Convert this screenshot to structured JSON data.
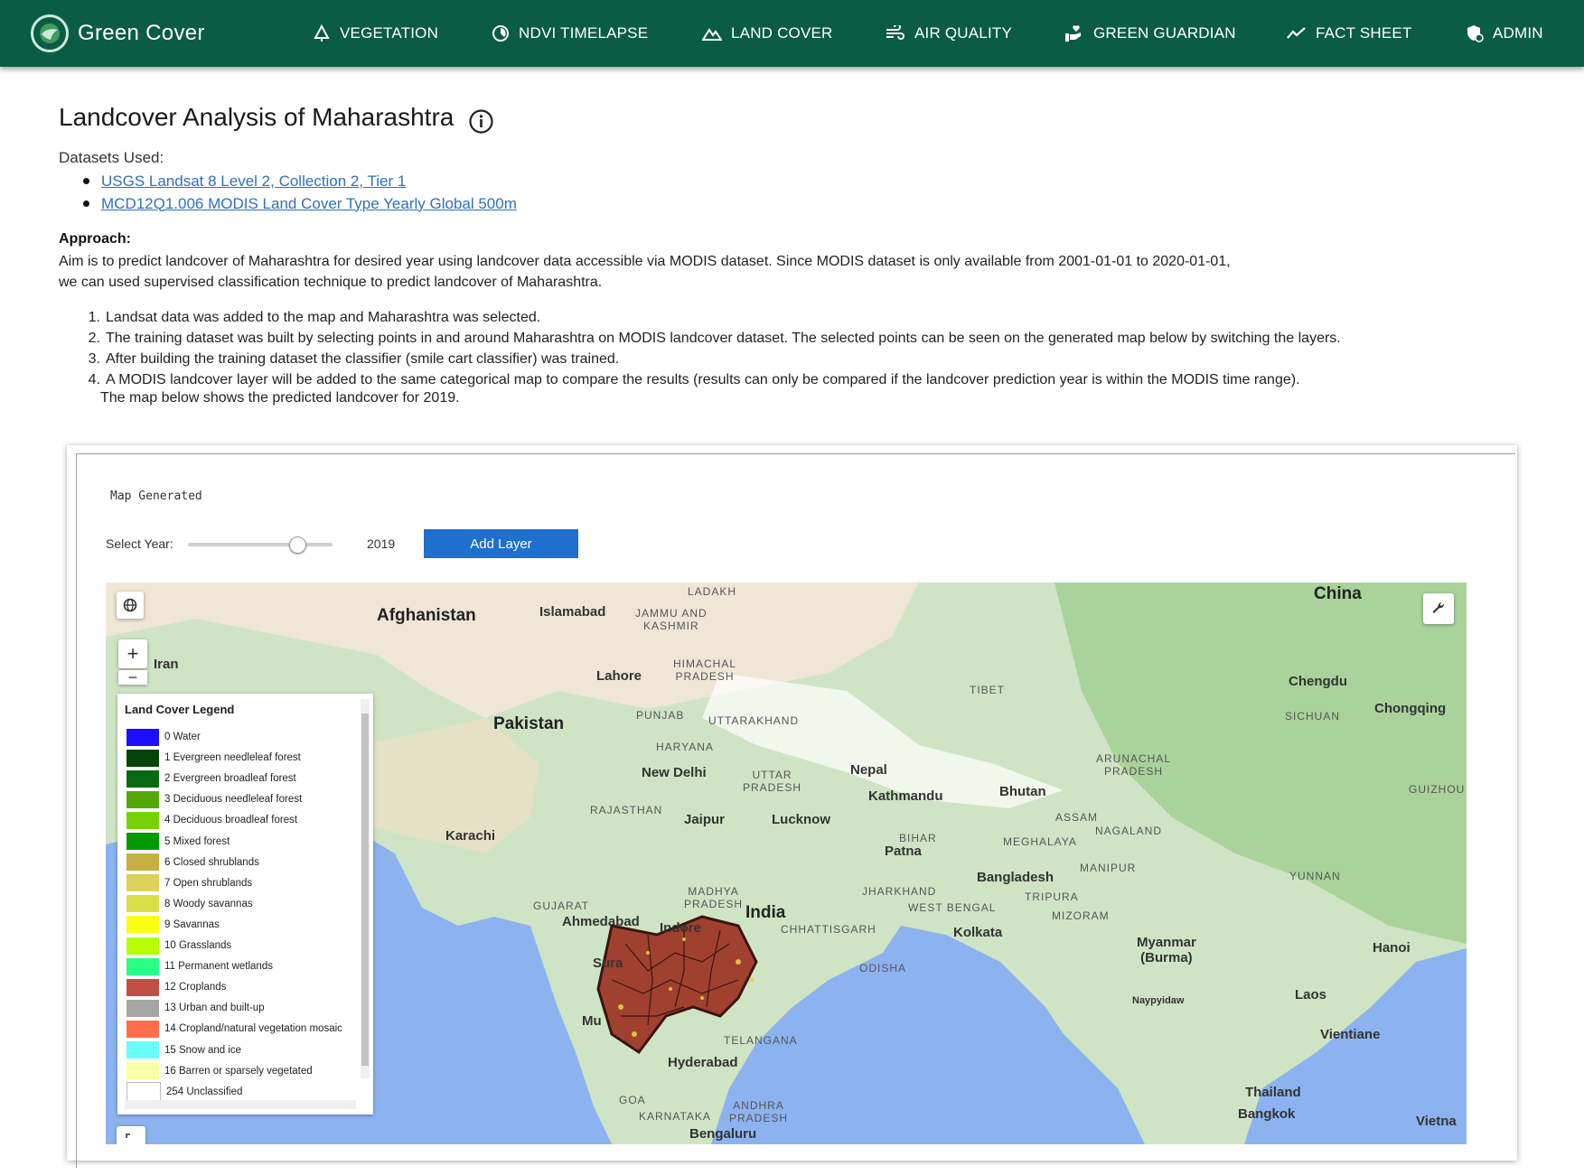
{
  "brand": {
    "title": "Green Cover"
  },
  "nav": [
    {
      "label": "VEGETATION",
      "icon": "tree-icon"
    },
    {
      "label": "NDVI TIMELAPSE",
      "icon": "timelapse-icon"
    },
    {
      "label": "LAND COVER",
      "icon": "terrain-icon"
    },
    {
      "label": "AIR QUALITY",
      "icon": "air-icon"
    },
    {
      "label": "GREEN GUARDIAN",
      "icon": "hand-heart-icon"
    },
    {
      "label": "FACT SHEET",
      "icon": "trend-line-icon"
    },
    {
      "label": "ADMIN",
      "icon": "admin-shield-icon"
    }
  ],
  "page": {
    "title": "Landcover Analysis of Maharashtra",
    "datasets_label": "Datasets Used:",
    "datasets": [
      "USGS Landsat 8 Level 2, Collection 2, Tier 1",
      "MCD12Q1.006 MODIS Land Cover Type Yearly Global 500m"
    ],
    "approach_label": "Approach:",
    "approach_line1": "Aim is to predict landcover of Maharashtra for desired year using landcover data accessible via MODIS dataset. Since MODIS dataset is only available from 2001-01-01 to 2020-01-01,",
    "approach_line2": "we can used supervised classification technique to predict landcover of Maharashtra.",
    "steps": [
      "Landsat data was added to the map and Maharashtra was selected.",
      "The training dataset was built by selecting points in and around Maharashtra on MODIS landcover dataset. The selected points can be seen on the generated map below by switching the layers.",
      "After building the training dataset the classifier (smile cart classifier) was trained.",
      "A MODIS landcover layer will be added to the same categorical map to compare the results (results can only be compared if the landcover prediction year is within the MODIS time range)."
    ],
    "steps_note": "The map below shows the predicted landcover for 2019."
  },
  "map_panel": {
    "status": "Map Generated",
    "select_year_label": "Select Year:",
    "year": "2019",
    "year_range": [
      2001,
      2020
    ],
    "add_layer_label": "Add Layer",
    "zoom_in": "+",
    "zoom_out": "−"
  },
  "legend": {
    "title": "Land Cover Legend",
    "items": [
      {
        "label": "0 Water",
        "color": "#1c0dff"
      },
      {
        "label": "1 Evergreen needleleaf forest",
        "color": "#05450a"
      },
      {
        "label": "2 Evergreen broadleaf forest",
        "color": "#086a10"
      },
      {
        "label": "3 Deciduous needleleaf forest",
        "color": "#54a708"
      },
      {
        "label": "4 Deciduous broadleaf forest",
        "color": "#78d203"
      },
      {
        "label": "5 Mixed forest",
        "color": "#009900"
      },
      {
        "label": "6 Closed shrublands",
        "color": "#c6b044"
      },
      {
        "label": "7 Open shrublands",
        "color": "#dcd159"
      },
      {
        "label": "8 Woody savannas",
        "color": "#dade48"
      },
      {
        "label": "9 Savannas",
        "color": "#fbff13"
      },
      {
        "label": "10 Grasslands",
        "color": "#b6ff05"
      },
      {
        "label": "11 Permanent wetlands",
        "color": "#27ff87"
      },
      {
        "label": "12 Croplands",
        "color": "#c24f44"
      },
      {
        "label": "13 Urban and built-up",
        "color": "#a5a5a5"
      },
      {
        "label": "14 Cropland/natural vegetation mosaic",
        "color": "#ff6d4c"
      },
      {
        "label": "15 Snow and ice",
        "color": "#69fff8"
      },
      {
        "label": "16 Barren or sparsely vegetated",
        "color": "#f9ffa4"
      },
      {
        "label": "254 Unclassified",
        "color": "#ffffff"
      }
    ]
  },
  "map_labels": {
    "china": "China",
    "afghanistan": "Afghanistan",
    "iran": "Iran",
    "pakistan": "Pakistan",
    "india": "India",
    "nepal": "Nepal",
    "bhutan": "Bhutan",
    "bangladesh": "Bangladesh",
    "myanmar": "Myanmar\n(Burma)",
    "laos": "Laos",
    "thailand": "Thailand",
    "vietnam": "Vietna",
    "tibet": "TIBET",
    "islamabad": "Islamabad",
    "lahore": "Lahore",
    "karachi": "Karachi",
    "new_delhi": "New Delhi",
    "jaipur": "Jaipur",
    "lucknow": "Lucknow",
    "kathmandu": "Kathmandu",
    "patna": "Patna",
    "kolkata": "Kolkata",
    "ahmedabad": "Ahmedabad",
    "indore": "Indore",
    "hyderabad": "Hyderabad",
    "bengaluru": "Bengaluru",
    "chengdu": "Chengdu",
    "chongqing": "Chongqing",
    "hanoi": "Hanoi",
    "vientiane": "Vientiane",
    "bangkok": "Bangkok",
    "naypyidaw": "Naypyidaw",
    "ladakh": "LADAKH",
    "jammu_kashmir": "JAMMU AND\nKASHMIR",
    "himachal": "HIMACHAL\nPRADESH",
    "punjab": "PUNJAB",
    "uttarakhand": "UTTARAKHAND",
    "haryana": "HARYANA",
    "uttar_pradesh": "UTTAR\nPRADESH",
    "rajasthan": "RAJASTHAN",
    "bihar": "BIHAR",
    "gujarat": "GUJARAT",
    "madhya_pradesh": "MADHYA\nPRADESH",
    "chhattisgarh": "CHHATTISGARH",
    "jharkhand": "JHARKHAND",
    "west_bengal": "WEST BENGAL",
    "odisha": "ODISHA",
    "telangana": "TELANGANA",
    "andhra": "ANDHRA\nPRADESH",
    "karnataka": "KARNATAKA",
    "goa": "GOA",
    "sikkim_assam": "ASSAM",
    "arunachal": "ARUNACHAL\nPRADESH",
    "meghalaya": "MEGHALAYA",
    "nagaland": "NAGALAND",
    "manipur": "MANIPUR",
    "tripura": "TRIPURA",
    "mizoram": "MIZORAM",
    "sichuan": "SICHUAN",
    "yunnan": "YUNNAN",
    "guizhou": "GUIZHOU",
    "surat": "Sura",
    "mumbai": "Mu"
  }
}
